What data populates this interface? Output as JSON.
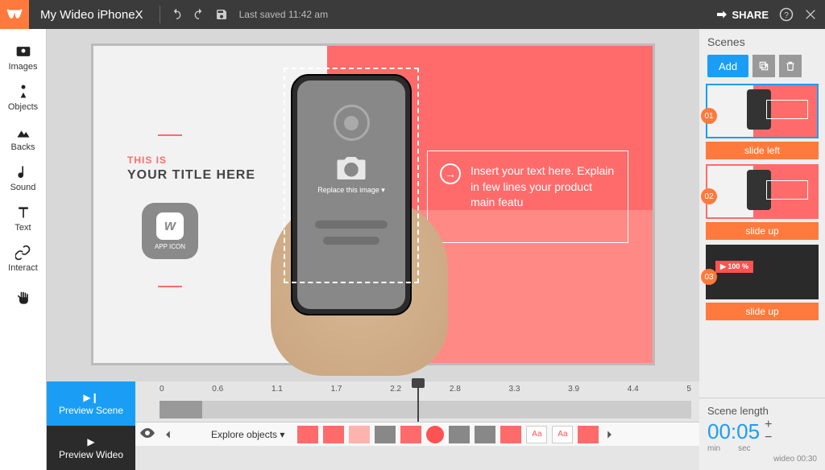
{
  "header": {
    "project_name": "My Wideo iPhoneX",
    "last_saved": "Last saved 11:42 am",
    "share": "SHARE"
  },
  "tools": {
    "images": "Images",
    "objects": "Objects",
    "backs": "Backs",
    "sound": "Sound",
    "text": "Text",
    "interact": "Interact"
  },
  "canvas": {
    "subtitle": "THIS IS",
    "title": "YOUR TITLE HERE",
    "app_icon": "APP ICON",
    "replace": "Replace this image ▾",
    "body_text": "Insert your text here. Explain in few lines your product main featu"
  },
  "timeline": {
    "preview_scene": "Preview Scene",
    "preview_wideo": "Preview Wideo",
    "explore": "Explore objects ▾",
    "ticks": [
      "0",
      "0.6",
      "1.1",
      "1.7",
      "2.2",
      "2.8",
      "3.3",
      "3.9",
      "4.4",
      "5"
    ],
    "aa": "Aa"
  },
  "scenes": {
    "header": "Scenes",
    "add": "Add",
    "items": [
      {
        "num": "01",
        "transition": "slide left"
      },
      {
        "num": "02",
        "transition": "slide up"
      },
      {
        "num": "03",
        "transition": "slide up",
        "badge": "▶ 100 %"
      }
    ]
  },
  "scene_length": {
    "title": "Scene length",
    "time": "00:05",
    "min": "min",
    "sec": "sec",
    "wideo": "wideo 00:30"
  }
}
